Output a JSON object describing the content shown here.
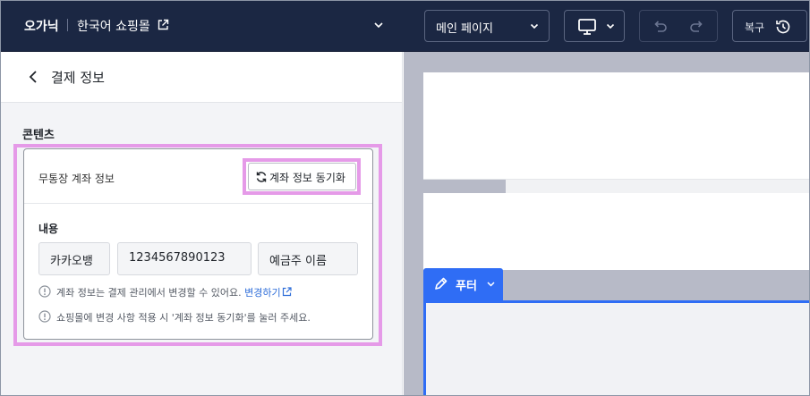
{
  "topbar": {
    "brand": "오가닉",
    "shop_name": "한국어 쇼핑몰",
    "page_select": "메인 페이지",
    "restore_label": "복구",
    "icons": [
      "external-link-icon",
      "chevron-down-icon",
      "monitor-icon",
      "undo-icon",
      "redo-icon",
      "history-icon"
    ]
  },
  "left_panel": {
    "title": "결제 정보",
    "section_label": "콘텐츠",
    "card": {
      "header_label": "무통장 계좌 정보",
      "sync_button": "계좌 정보 동기화",
      "content_label": "내용",
      "fields": {
        "bank": "카카오뱅",
        "account": "1234567890123",
        "holder": "예금주 이름"
      },
      "note1_text": "계좌 정보는 결제 관리에서 변경할 수 있어요.",
      "note1_link": "변경하기",
      "note2_text": "쇼핑몰에 변경 사항 적용 시 '계좌 정보 동기화'를 눌러 주세요."
    }
  },
  "preview": {
    "footer_tag": "푸터"
  },
  "colors": {
    "topbar_bg": "#1b2743",
    "highlight": "#e59ae8",
    "accent_blue": "#2f6df5",
    "link": "#2f6ed9"
  }
}
